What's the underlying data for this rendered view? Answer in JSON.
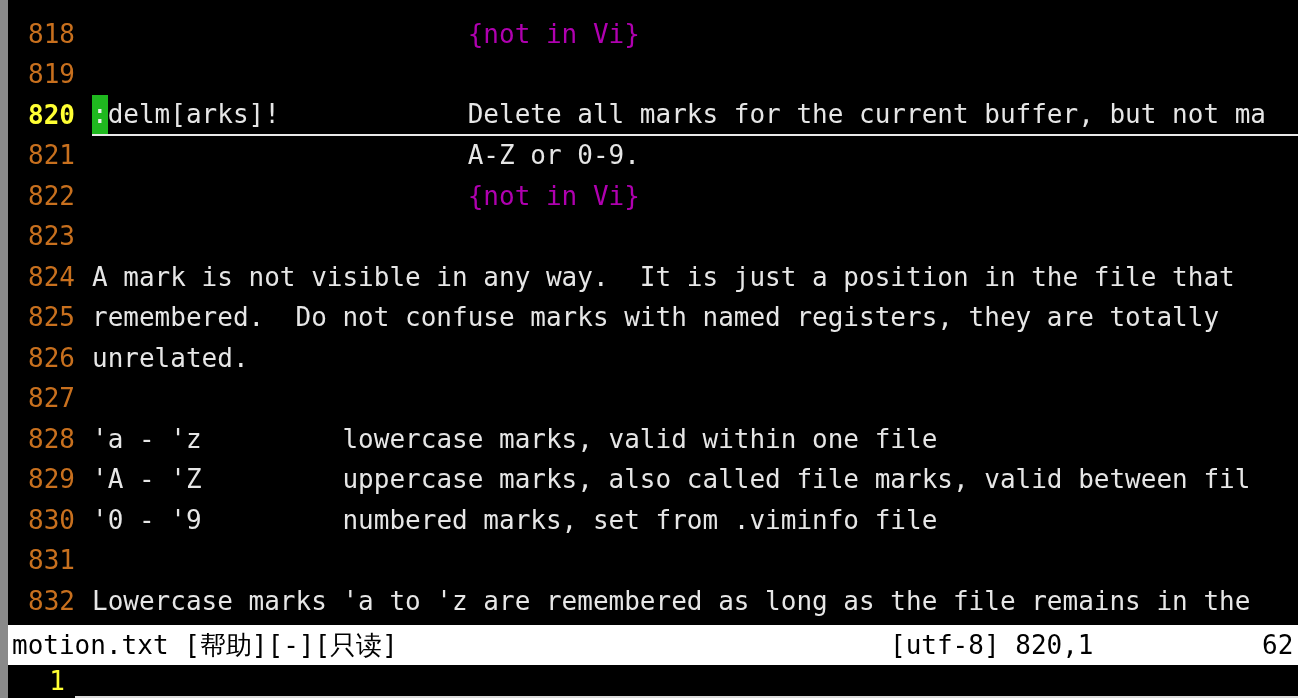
{
  "editor": {
    "lines": [
      {
        "number": "818",
        "current": false,
        "segments": [
          {
            "kind": "special",
            "text": "                        {not in Vi}"
          }
        ]
      },
      {
        "number": "819",
        "current": false
      },
      {
        "number": "820",
        "current": true,
        "segments": [
          {
            "kind": "cursor",
            "text": ":"
          },
          {
            "kind": "normal",
            "text": "delm[arks]!"
          },
          {
            "kind": "normal",
            "text": "            Delete all marks for the current buffer, but not ma"
          }
        ]
      },
      {
        "number": "821",
        "current": false,
        "segments": [
          {
            "kind": "normal",
            "text": "                        A-Z or 0-9."
          }
        ]
      },
      {
        "number": "822",
        "current": false,
        "segments": [
          {
            "kind": "special",
            "text": "                        {not in Vi}"
          }
        ]
      },
      {
        "number": "823",
        "current": false
      },
      {
        "number": "824",
        "current": false,
        "segments": [
          {
            "kind": "normal",
            "text": "A mark is not visible in any way.  It is just a position in the file that"
          }
        ]
      },
      {
        "number": "825",
        "current": false,
        "segments": [
          {
            "kind": "normal",
            "text": "remembered.  Do not confuse marks with named registers, they are totally"
          }
        ]
      },
      {
        "number": "826",
        "current": false,
        "segments": [
          {
            "kind": "normal",
            "text": "unrelated."
          }
        ]
      },
      {
        "number": "827",
        "current": false
      },
      {
        "number": "828",
        "current": false,
        "segments": [
          {
            "kind": "normal",
            "text": "'a - 'z"
          },
          {
            "kind": "normal",
            "text": "         lowercase marks, valid within one file"
          }
        ]
      },
      {
        "number": "829",
        "current": false,
        "segments": [
          {
            "kind": "normal",
            "text": "'A - 'Z"
          },
          {
            "kind": "normal",
            "text": "         uppercase marks, also called file marks, valid between fil"
          }
        ]
      },
      {
        "number": "830",
        "current": false,
        "segments": [
          {
            "kind": "normal",
            "text": "'0 - '9"
          },
          {
            "kind": "normal",
            "text": "         numbered marks, set from .viminfo file"
          }
        ]
      },
      {
        "number": "831",
        "current": false
      },
      {
        "number": "832",
        "current": false,
        "segments": [
          {
            "kind": "normal",
            "text": "Lowercase marks 'a to 'z are remembered as long as the file remains in the"
          }
        ]
      }
    ]
  },
  "status_bar": {
    "file": "motion.txt [帮助][-][只读]",
    "encoding_position": "[utf-8] 820,1",
    "percent": "62"
  },
  "command_line": {
    "line_number": "1"
  }
}
